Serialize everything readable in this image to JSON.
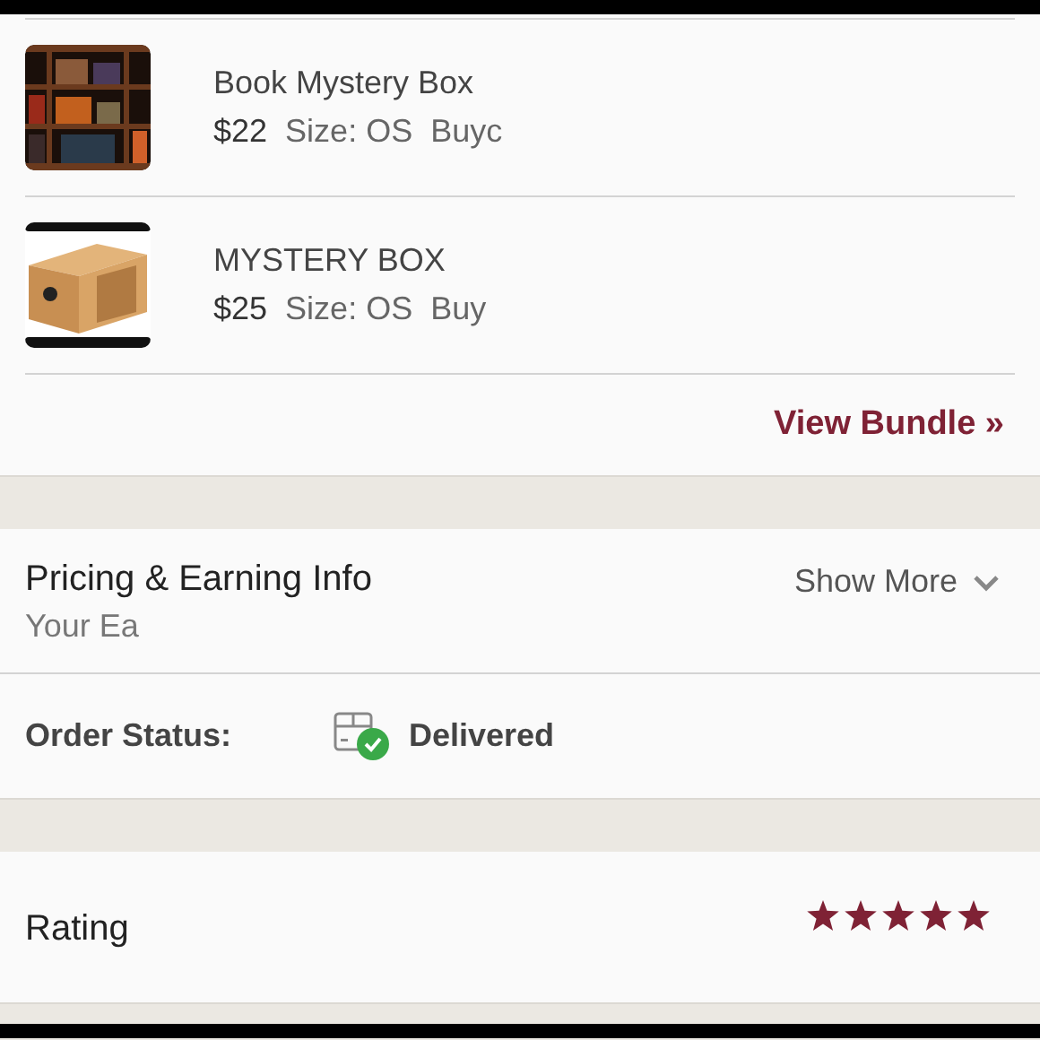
{
  "items": [
    {
      "kind": "books",
      "title": "Book Mystery Box",
      "price": "$22",
      "size": "Size: OS",
      "buyer": "Buyc"
    },
    {
      "kind": "box",
      "title": "MYSTERY BOX",
      "price": "$25",
      "size": "Size: OS",
      "buyer": "Buy"
    }
  ],
  "view_bundle": "View Bundle »",
  "pricing": {
    "title": "Pricing & Earning Info",
    "subtitle": "Your Ea",
    "toggle": "Show More",
    "expanded": false
  },
  "order_status": {
    "label": "Order Status:",
    "value": "Delivered"
  },
  "rating": {
    "label": "Rating",
    "stars": 5
  }
}
